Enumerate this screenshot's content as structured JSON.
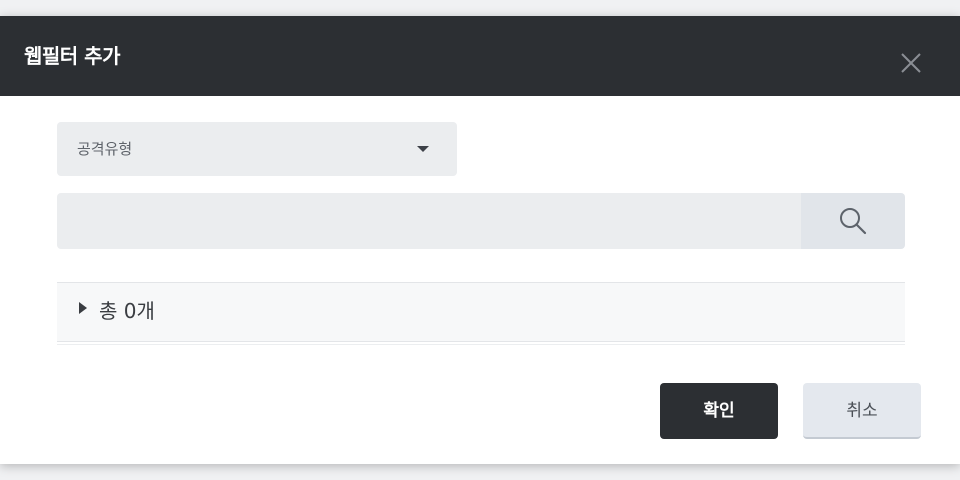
{
  "dialog": {
    "title": "웹필터 추가",
    "close_icon": "close-icon"
  },
  "filter": {
    "attack_type_selected": "공격유형",
    "caret_icon": "caret-down-icon"
  },
  "search": {
    "value": "",
    "icon": "search-icon"
  },
  "list": {
    "total_label": "총 0개",
    "toggle_icon": "caret-right-icon"
  },
  "buttons": {
    "confirm_label": "확인",
    "cancel_label": "취소"
  },
  "colors": {
    "header_bg": "#2c2f33",
    "confirm_bg": "#2c2f33",
    "cancel_bg": "#e4e8ee",
    "field_bg": "#ebedef"
  }
}
